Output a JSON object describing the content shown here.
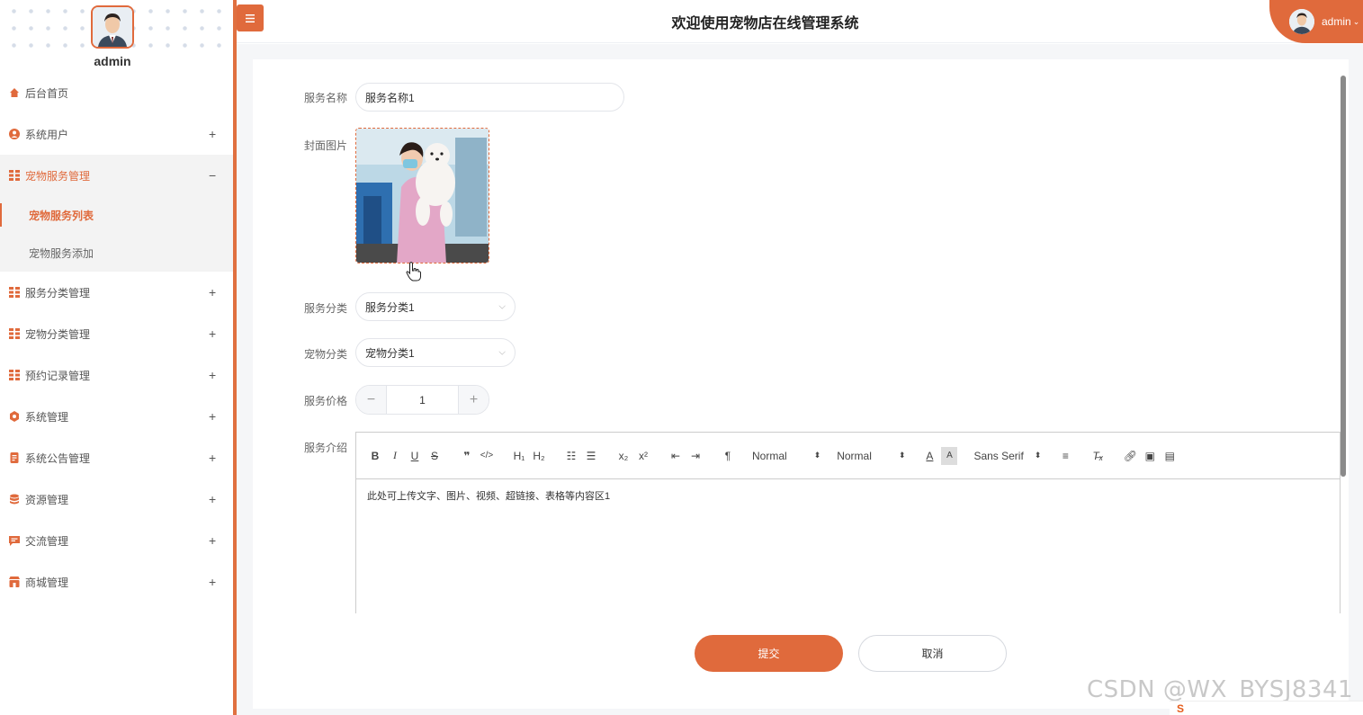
{
  "sidebar": {
    "username": "admin",
    "items": [
      {
        "label": "后台首页",
        "icon": "home-icon",
        "toggle": ""
      },
      {
        "label": "系统用户",
        "icon": "user-icon",
        "toggle": "+"
      },
      {
        "label": "宠物服务管理",
        "icon": "grid-icon",
        "toggle": "−"
      },
      {
        "label": "服务分类管理",
        "icon": "grid-icon",
        "toggle": "+"
      },
      {
        "label": "宠物分类管理",
        "icon": "grid-icon",
        "toggle": "+"
      },
      {
        "label": "预约记录管理",
        "icon": "grid-icon",
        "toggle": "+"
      },
      {
        "label": "系统管理",
        "icon": "settings-icon",
        "toggle": "+"
      },
      {
        "label": "系统公告管理",
        "icon": "document-icon",
        "toggle": "+"
      },
      {
        "label": "资源管理",
        "icon": "database-icon",
        "toggle": "+"
      },
      {
        "label": "交流管理",
        "icon": "chat-icon",
        "toggle": "+"
      },
      {
        "label": "商城管理",
        "icon": "shop-icon",
        "toggle": "+"
      }
    ],
    "subitems": [
      {
        "label": "宠物服务列表",
        "active": true
      },
      {
        "label": "宠物服务添加",
        "active": false
      }
    ]
  },
  "header": {
    "title": "欢迎使用宠物店在线管理系统",
    "user_label": "admin"
  },
  "form": {
    "service_name_label": "服务名称",
    "service_name_value": "服务名称1",
    "cover_label": "封面图片",
    "service_category_label": "服务分类",
    "service_category_value": "服务分类1",
    "pet_category_label": "宠物分类",
    "pet_category_value": "宠物分类1",
    "price_label": "服务价格",
    "price_value": "1",
    "intro_label": "服务介绍",
    "intro_content": "此处可上传文字、图片、视频、超链接、表格等内容区1",
    "submit_label": "提交",
    "cancel_label": "取消"
  },
  "editor_toolbar": {
    "header_select": "Normal",
    "size_select": "Normal",
    "font_select": "Sans Serif"
  },
  "watermark": "CSDN @WX_BYSJ8341",
  "colors": {
    "accent": "#e06a3c"
  }
}
